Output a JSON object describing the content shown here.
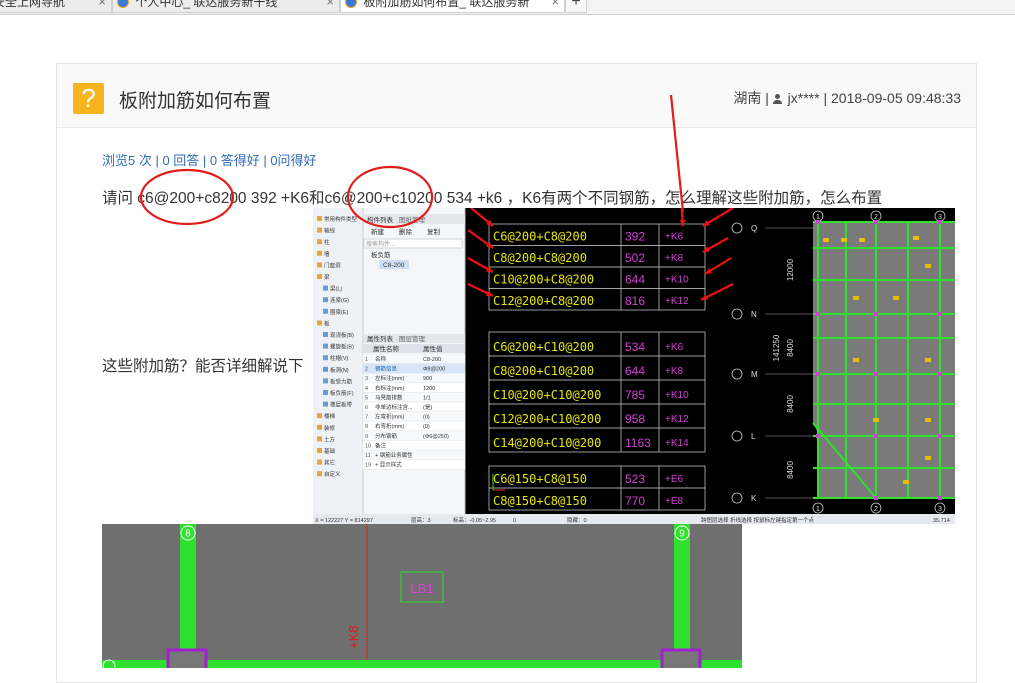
{
  "browser": {
    "tabs": [
      {
        "label": "安全上网导航",
        "active": false
      },
      {
        "label": "个人中心_ 联达服务新干线",
        "active": false
      },
      {
        "label": "板附加筋如何布置_ 联达服务新",
        "active": true
      }
    ],
    "close_glyph": "×",
    "new_tab_glyph": "+"
  },
  "question": {
    "badge": "?",
    "title": "板附加筋如何布置",
    "region": "湖南",
    "user": "jx****",
    "datetime": "2018-09-05 09:48:33",
    "stats": "浏览5 次 | 0 回答 | 0 答得好 | 0问得好",
    "body_line1": "请问  c6@200+c8200  392  +K6和c6@200+c10200  534  +k6 ，K6有两个不同钢筋，怎么理解这些附加筋，怎么布置",
    "body_line2": "这些附加筋？能否详细解说下"
  },
  "screenshot1": {
    "tree_tabs": [
      "构件列表",
      "图纸管理"
    ],
    "tree_toolbar": [
      "新建",
      "删除",
      "复制"
    ],
    "search_placeholder": "搜索构件...",
    "tree_root": "板负筋",
    "tree_selected": "C8-200",
    "nav_items": [
      "常用构件类型",
      "轴线",
      "柱",
      "墙",
      "门窗洞",
      "梁",
      "梁(L)",
      "连梁(G)",
      "圈梁(E)",
      "板",
      "现浇板(B)",
      "螺旋板(B)",
      "柱帽(V)",
      "板洞(N)",
      "板受力筋",
      "板负筋(F)",
      "楼层板带",
      "楼梯",
      "装修",
      "土方",
      "基础",
      "其它",
      "自定义"
    ],
    "prop_tabs": [
      "属性列表",
      "图层管理"
    ],
    "prop_header": [
      "属性名称",
      "属性值"
    ],
    "props": [
      [
        "1",
        "名称",
        "C8-200"
      ],
      [
        "2",
        "钢筋信息",
        "Φ8@200"
      ],
      [
        "3",
        "左标注(mm)",
        "900"
      ],
      [
        "4",
        "右标注(mm)",
        "1200"
      ],
      [
        "5",
        "马凳筋排数",
        "1/1"
      ],
      [
        "6",
        "非单边标注含...",
        "(是)"
      ],
      [
        "7",
        "左弯折(mm)",
        "(0)"
      ],
      [
        "8",
        "右弯折(mm)",
        "(0)"
      ],
      [
        "9",
        "分布钢筋",
        "(Φ6@250)"
      ],
      [
        "10",
        "备注",
        ""
      ],
      [
        "11",
        "+ 钢筋业务属性",
        ""
      ],
      [
        "19",
        "+ 显示样式",
        ""
      ]
    ],
    "table1": [
      [
        "C6@200+C8@200",
        "392",
        "+K6"
      ],
      [
        "C8@200+C8@200",
        "502",
        "+K8"
      ],
      [
        "C10@200+C8@200",
        "644",
        "+K10"
      ],
      [
        "C12@200+C8@200",
        "816",
        "+K12"
      ]
    ],
    "table2": [
      [
        "C6@200+C10@200",
        "534",
        "+K6"
      ],
      [
        "C8@200+C10@200",
        "644",
        "+K8"
      ],
      [
        "C10@200+C10@200",
        "785",
        "+K10"
      ],
      [
        "C12@200+C10@200",
        "958",
        "+K12"
      ],
      [
        "C14@200+C10@200",
        "1163",
        "+K14"
      ]
    ],
    "table3": [
      [
        "C6@150+C8@150",
        "523",
        "+E6"
      ],
      [
        "C8@150+C8@150",
        "770",
        "+E8"
      ]
    ],
    "axis_letters": [
      "Q",
      "N",
      "M",
      "L",
      "K"
    ],
    "axis_numbers": [
      "1",
      "2",
      "3"
    ],
    "dims": [
      "12000",
      "141250",
      "8400",
      "8400",
      "8400"
    ],
    "status_bar": {
      "coords": "X = 122227 Y = 814297",
      "floor": "层高：3",
      "elev": "标高：-0.05~2.95",
      "zero": "0",
      "hidden": "隐藏：0",
      "mode": "跨图层选择  折线选择  按鼠标左键指定第一个点",
      "value": "35.714"
    },
    "colors": {
      "green": "#2fe02f",
      "magenta": "#d040d0",
      "yellow": "#e6e600",
      "red": "#ee1111",
      "cad_bg": "#000000"
    }
  },
  "screenshot2": {
    "axis_8": "8",
    "axis_9": "9",
    "label_box": "LB1",
    "vertical_label": "+K8"
  }
}
